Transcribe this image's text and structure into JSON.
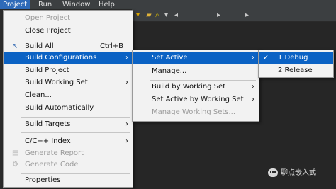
{
  "menubar": {
    "items": [
      "Project",
      "Run",
      "Window",
      "Help"
    ]
  },
  "toolbar": {
    "icons": [
      "toolbar-arrow-icon",
      "folder-icon",
      "search-icon",
      "dropdown-icon",
      "back-icon",
      "forward-icon",
      "nav-icon"
    ]
  },
  "project_menu": {
    "items": [
      {
        "label": "Open Project",
        "disabled": true
      },
      {
        "label": "Close Project"
      },
      {
        "label": "Build All",
        "accelerator": "Ctrl+B"
      },
      {
        "label": "Build Configurations",
        "submenu": true,
        "highlighted": true
      },
      {
        "label": "Build Project"
      },
      {
        "label": "Build Working Set",
        "submenu": true
      },
      {
        "label": "Clean..."
      },
      {
        "label": "Build Automatically"
      },
      {
        "label": "Build Targets",
        "submenu": true
      },
      {
        "label": "C/C++ Index",
        "submenu": true
      },
      {
        "label": "Generate Report",
        "disabled": true
      },
      {
        "label": "Generate Code",
        "disabled": true
      },
      {
        "label": "Properties"
      }
    ]
  },
  "build_config_menu": {
    "items": [
      {
        "label": "Set Active",
        "submenu": true,
        "highlighted": true
      },
      {
        "label": "Manage..."
      },
      {
        "label": "Build by Working Set",
        "submenu": true
      },
      {
        "label": "Set Active by Working Set",
        "submenu": true
      },
      {
        "label": "Manage Working Sets...",
        "disabled": true
      }
    ]
  },
  "set_active_menu": {
    "items": [
      {
        "label": "1 Debug",
        "checked": true,
        "highlighted": true
      },
      {
        "label": "2 Release"
      }
    ]
  },
  "colors": {
    "highlight": "#0b62c4",
    "menu_bg": "#f2f2f2",
    "ide_bg": "#2b2b2b"
  },
  "watermark": {
    "text": "聊点嵌入式"
  }
}
